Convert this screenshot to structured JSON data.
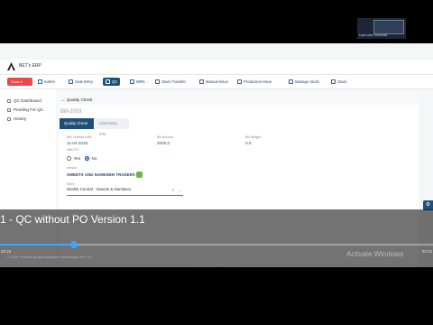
{
  "app": {
    "title": "BET's ERP",
    "user": "Upendra Khandar"
  },
  "nav": {
    "store_label": "Store",
    "items": [
      "Indent",
      "Gate Entry",
      "QC",
      "MRN",
      "Stock Transfer",
      "Manual Issue",
      "Production Issue",
      "Manage Stock",
      "Stock"
    ],
    "active": "QC"
  },
  "sidebar": {
    "items": [
      "QC Dashboard",
      "Pending For QC",
      "History"
    ]
  },
  "main": {
    "back_label": "Quality Check",
    "bill_id": "Bill-2003",
    "tabs": [
      "Quality Check",
      "Gate Entry Info"
    ],
    "fields": {
      "bill_challan_date": {
        "label": "Bill/ Challan Date",
        "value": "11-04-2025"
      },
      "bill_amount": {
        "label": "Bill Amount",
        "value": "2000.0"
      },
      "bill_weight": {
        "label": "Bill Weight",
        "value": "0.0"
      }
    },
    "with_po": {
      "label": "With PO",
      "options": [
        "Yes",
        "No"
      ],
      "selected": "No"
    },
    "vendor": {
      "label": "Vendor",
      "name": "SWEETS AND NAMKEEN TRADERS"
    },
    "store": {
      "label": "Store",
      "value": "Nashik Central - Sweets & Namkeen",
      "clear": "×",
      "chevron": "⌄"
    }
  },
  "video": {
    "caption": "1 - QC without PO Version 1.1",
    "time_elapsed": "00:25",
    "time_total": "00:25",
    "progress": 0.17,
    "watermark": "Activate Windows",
    "footer": "© 2025, Powered by Byte-Elephants Technologies Pvt. Ltd."
  },
  "colors": {
    "brand": "#1f4e79",
    "store": "#e84b4b",
    "progress": "#3ea6ff"
  },
  "icons": [
    "logo-icon",
    "gear-icon",
    "vendor-icon",
    "store-icon"
  ]
}
